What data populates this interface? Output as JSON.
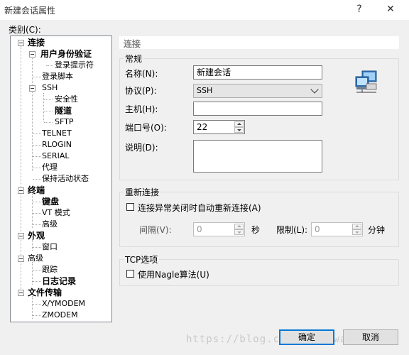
{
  "window": {
    "title": "新建会话属性",
    "help_glyph": "?",
    "close_glyph": "✕"
  },
  "category_label": "类别(C):",
  "tree": {
    "connection": "连接",
    "user_auth": "用户身份验证",
    "login_prompt": "登录提示符",
    "login_script": "登录脚本",
    "ssh": "SSH",
    "security": "安全性",
    "tunnel": "隧道",
    "sftp": "SFTP",
    "telnet": "TELNET",
    "rlogin": "RLOGIN",
    "serial": "SERIAL",
    "proxy": "代理",
    "keepalive": "保持活动状态",
    "terminal": "终端",
    "keyboard": "键盘",
    "vt_mode": "VT 模式",
    "advanced": "高级",
    "appearance": "外观",
    "window": "窗口",
    "advanced2": "高级",
    "trace": "跟踪",
    "logging": "日志记录",
    "file_transfer": "文件传输",
    "xymodem": "X/YMODEM",
    "zmodem": "ZMODEM"
  },
  "panel_title": "连接",
  "general": {
    "legend": "常规",
    "name_label": "名称(N):",
    "name_value": "新建会话",
    "protocol_label": "协议(P):",
    "protocol_value": "SSH",
    "host_label": "主机(H):",
    "host_value": "",
    "port_label": "端口号(O):",
    "port_value": "22",
    "desc_label": "说明(D):",
    "desc_value": ""
  },
  "reconnect": {
    "legend": "重新连接",
    "auto_label": "连接异常关闭时自动重新连接(A)",
    "interval_label": "间隔(V):",
    "interval_value": "0",
    "seconds_label": "秒",
    "limit_label": "限制(L):",
    "limit_value": "0",
    "minutes_label": "分钟"
  },
  "tcp": {
    "legend": "TCP选项",
    "nagle_label": "使用Nagle算法(U)"
  },
  "buttons": {
    "ok": "确定",
    "cancel": "取消"
  },
  "watermark": "https://blog.csdn.net/wa...208",
  "colors": {
    "accent": "#0078d7",
    "window_bg": "#f0f0f0"
  }
}
